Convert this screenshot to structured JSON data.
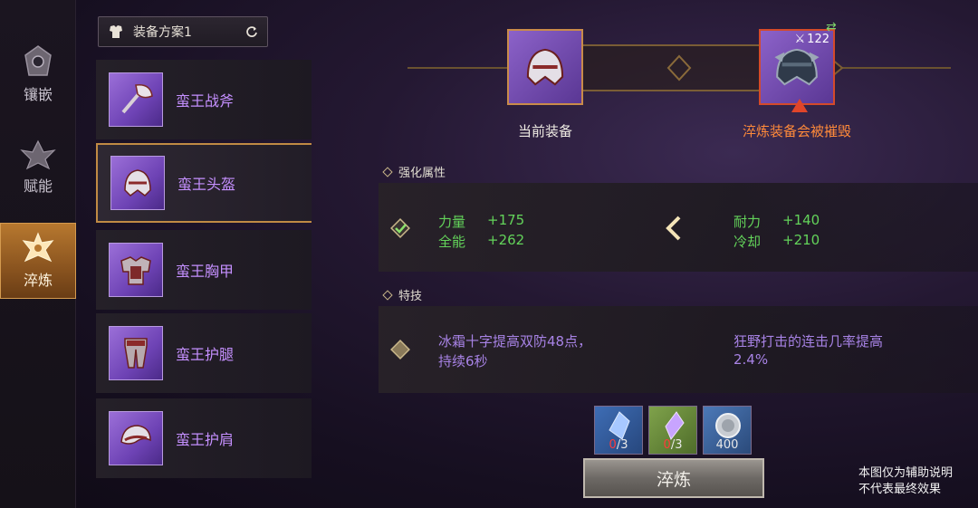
{
  "leftnav": {
    "items": [
      {
        "label": "镶嵌",
        "icon": "gem-socket-icon",
        "active": false
      },
      {
        "label": "赋能",
        "icon": "empower-icon",
        "active": false
      },
      {
        "label": "淬炼",
        "icon": "refine-icon",
        "active": true
      }
    ]
  },
  "plan": {
    "label": "装备方案1",
    "icon": "armor-icon",
    "refresh_icon": "refresh-icon"
  },
  "equipment": [
    {
      "name": "蛮王战斧",
      "icon": "axe-icon",
      "active": false
    },
    {
      "name": "蛮王头盔",
      "icon": "helmet-icon",
      "active": true
    },
    {
      "name": "蛮王胸甲",
      "icon": "chest-armor-icon",
      "active": false
    },
    {
      "name": "蛮王护腿",
      "icon": "leg-armor-icon",
      "active": false
    },
    {
      "name": "蛮王护肩",
      "icon": "shoulder-armor-icon",
      "active": false
    }
  ],
  "compare": {
    "current_label": "当前装备",
    "target_warning": "淬炼装备会被摧毁",
    "target_level": "122",
    "warning_color": "#ff8a3a"
  },
  "enhance": {
    "title": "强化属性",
    "current": [
      {
        "name": "力量",
        "value": "+175"
      },
      {
        "name": "全能",
        "value": "+262"
      }
    ],
    "target": [
      {
        "name": "耐力",
        "value": "+140"
      },
      {
        "name": "冷却",
        "value": "+210"
      }
    ]
  },
  "skill": {
    "title": "特技",
    "current_line1": "冰霜十字提高双防48点，",
    "current_line2": "持续6秒",
    "target_line1": "狂野打击的连击几率提高",
    "target_line2": "2.4%"
  },
  "materials": [
    {
      "have": "0",
      "need": "/3",
      "icon": "blue-crystal-icon"
    },
    {
      "have": "0",
      "need": "/3",
      "icon": "purple-crystal-icon"
    },
    {
      "amount": "400",
      "icon": "silver-coin-icon"
    }
  ],
  "refine_button": "淬炼",
  "note": {
    "line1": "本图仅为辅助说明",
    "line2": "不代表最终效果"
  }
}
